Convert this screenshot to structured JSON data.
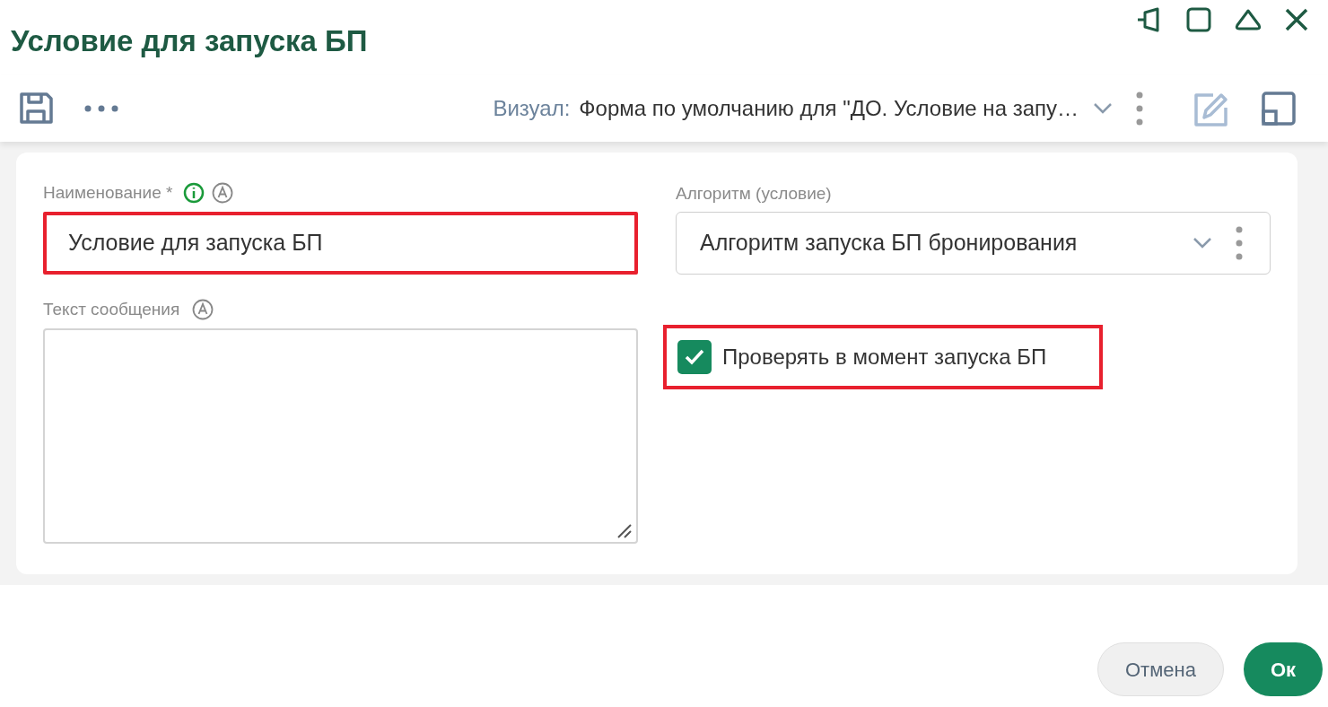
{
  "window": {
    "title": "Условие для запуска БП"
  },
  "toolbar": {
    "visual_label": "Визуал:",
    "visual_value": "Форма по умолчанию для \"ДО. Условие на запу…"
  },
  "form": {
    "name": {
      "label": "Наименование *",
      "value": "Условие для запуска БП",
      "highlighted": true
    },
    "algorithm": {
      "label": "Алгоритм (условие)",
      "value": "Алгоритм запуска БП бронирования",
      "highlighted": false
    },
    "message": {
      "label": "Текст сообщения",
      "highlighted": false
    },
    "check": {
      "label": "Проверять в момент запуска БП",
      "checked": true,
      "highlighted": true
    }
  },
  "buttons": [
    {
      "label": "Отмена",
      "kind": "secondary"
    },
    {
      "label": "Ок",
      "kind": "primary"
    }
  ]
}
